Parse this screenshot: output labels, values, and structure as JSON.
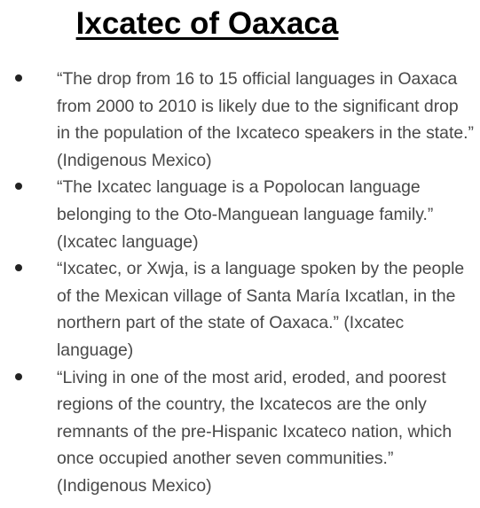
{
  "title": "Ixcatec of Oaxaca",
  "bullets": [
    {
      "text": "“The drop from 16 to 15 official languages in Oaxaca from 2000 to 2010 is likely due to the significant drop in the population of the Ixcateco speakers in the state.” (Indigenous Mexico)"
    },
    {
      "text": "“The Ixcatec language is a Popolocan language belonging to the Oto-Manguean language family.” (Ixcatec language)"
    },
    {
      "text": "“Ixcatec, or Xwja, is a language spoken by the people of the Mexican village of Santa María Ixcatlan, in the northern part of the state of Oaxaca.” (Ixcatec language)"
    },
    {
      "text": "“Living in one of the most arid, eroded, and poorest regions of the country, the Ixcatecos are the only remnants of the pre-Hispanic Ixcateco nation, which once occupied another seven communities.” (Indigenous Mexico)"
    }
  ]
}
